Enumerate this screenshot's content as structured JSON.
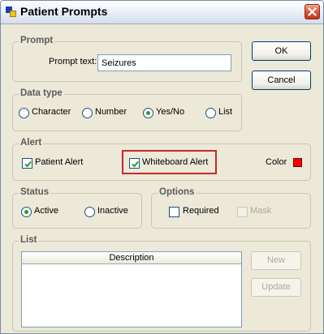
{
  "window": {
    "title": "Patient Prompts",
    "icons": {
      "app": "app-logo-icon",
      "close": "close-icon"
    }
  },
  "buttons": {
    "ok": "OK",
    "cancel": "Cancel",
    "new": "New",
    "update": "Update"
  },
  "prompt": {
    "legend": "Prompt",
    "label": "Prompt text:",
    "value": "Seizures"
  },
  "data_type": {
    "legend": "Data type",
    "options": [
      {
        "label": "Character",
        "selected": false
      },
      {
        "label": "Number",
        "selected": false
      },
      {
        "label": "Yes/No",
        "selected": true
      },
      {
        "label": "List",
        "selected": false
      }
    ]
  },
  "alert": {
    "legend": "Alert",
    "patient_alert": {
      "label": "Patient Alert",
      "checked": true
    },
    "whiteboard_alert": {
      "label": "Whiteboard Alert",
      "checked": true
    },
    "color_label": "Color",
    "color_value": "#ff0000",
    "highlight_color": "#c62828"
  },
  "status": {
    "legend": "Status",
    "options": [
      {
        "label": "Active",
        "selected": true
      },
      {
        "label": "Inactive",
        "selected": false
      }
    ]
  },
  "options": {
    "legend": "Options",
    "required": {
      "label": "Required",
      "checked": false
    },
    "mask": {
      "label": "Mask",
      "checked": false,
      "disabled": true
    }
  },
  "list": {
    "legend": "List",
    "columns": [
      "Description"
    ],
    "rows": []
  }
}
